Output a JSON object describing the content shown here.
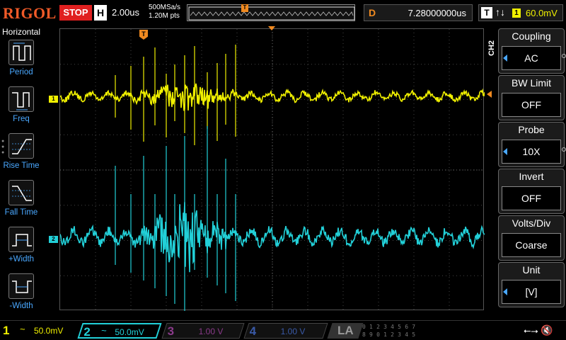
{
  "top": {
    "brand": "RIGOL",
    "run_state": "STOP",
    "h_label": "H",
    "timebase": "2.00us",
    "sample_rate": "500MSa/s",
    "points": "1.20M pts",
    "delay_label": "D",
    "delay_value": "7.28000000us",
    "trigger_type": "T",
    "trigger_edge": "↑↓",
    "trigger_source": "1",
    "trigger_level": "60.0mV",
    "memory_trigger_marker": "T"
  },
  "left_panel": {
    "title": "Horizontal",
    "items": [
      {
        "label": "Period",
        "icon": "period-icon"
      },
      {
        "label": "Freq",
        "icon": "freq-icon"
      },
      {
        "label": "Rise Time",
        "icon": "rise-time-icon"
      },
      {
        "label": "Fall Time",
        "icon": "fall-time-icon"
      },
      {
        "label": "+Width",
        "icon": "pos-width-icon"
      },
      {
        "label": "-Width",
        "icon": "neg-width-icon"
      }
    ]
  },
  "screen": {
    "ch1_marker": "1",
    "ch2_marker": "2",
    "trigger_pos_marker": "T"
  },
  "right_panel": {
    "channel": "CH2",
    "items": [
      {
        "title": "Coupling",
        "value": "AC"
      },
      {
        "title": "BW Limit",
        "value": "OFF"
      },
      {
        "title": "Probe",
        "value": "10X"
      },
      {
        "title": "Invert",
        "value": "OFF"
      },
      {
        "title": "Volts/Div",
        "value": "Coarse"
      },
      {
        "title": "Unit",
        "value": "[V]"
      }
    ]
  },
  "bottom": {
    "ch1": {
      "num": "1",
      "coupling": "~",
      "scale": "50.0mV"
    },
    "ch2": {
      "num": "2",
      "coupling": "~",
      "scale": "50.0mV"
    },
    "ch3": {
      "num": "3",
      "coupling": "",
      "scale": "1.00 V"
    },
    "ch4": {
      "num": "4",
      "coupling": "",
      "scale": "1.00 V"
    },
    "la": "LA",
    "digital_row1": "0 1 2 3  4 5 6 7",
    "digital_row2": "8 9 0 1  2 3 4 5"
  },
  "colors": {
    "ch1": "#f0f000",
    "ch2": "#22d0d8",
    "ch3": "#8a3a8a",
    "ch4": "#3a5aa8",
    "trigger": "#f08a20",
    "stop": "#e02020",
    "accent": "#4aa8ff"
  }
}
